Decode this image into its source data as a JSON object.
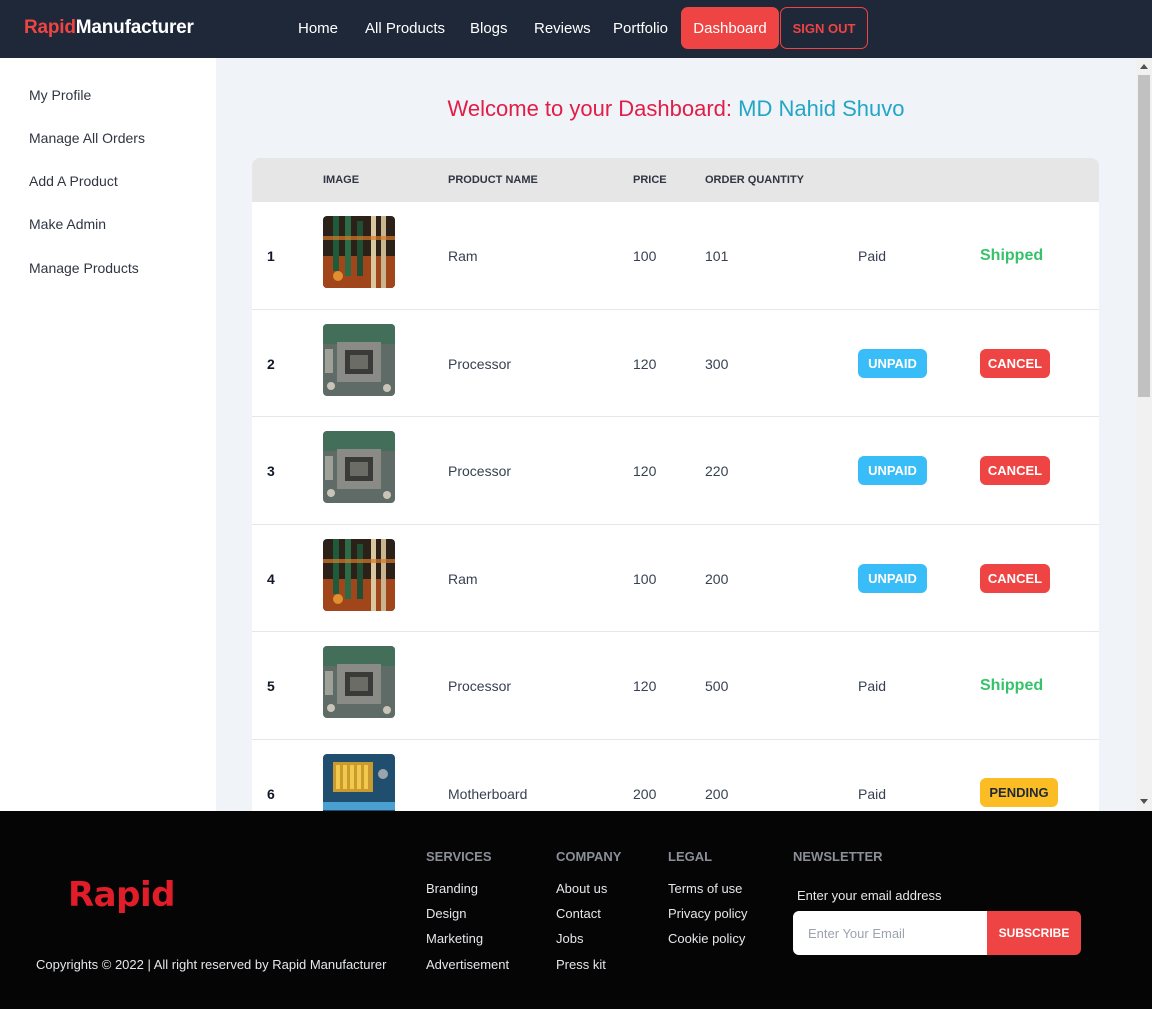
{
  "navbar": {
    "brand_accent": "Rapid",
    "brand_rest": "Manufacturer",
    "links": [
      "Home",
      "All Products",
      "Blogs",
      "Reviews",
      "Portfolio"
    ],
    "dashboard": "Dashboard",
    "signout": "SIGN OUT"
  },
  "sidebar": {
    "items": [
      "My Profile",
      "Manage All Orders",
      "Add A Product",
      "Make Admin",
      "Manage Products"
    ]
  },
  "main": {
    "welcome_prefix": "Welcome to your Dashboard:",
    "user_name": "MD Nahid Shuvo"
  },
  "table": {
    "headers": [
      "IMAGE",
      "PRODUCT NAME",
      "PRICE",
      "ORDER QUANTITY"
    ],
    "rows": [
      {
        "num": "1",
        "image": "ram",
        "name": "Ram",
        "price": "100",
        "qty": "101",
        "payment": "Paid",
        "status": "Shipped"
      },
      {
        "num": "2",
        "image": "processor",
        "name": "Processor",
        "price": "120",
        "qty": "300",
        "payment": "UNPAID",
        "status": "CANCEL"
      },
      {
        "num": "3",
        "image": "processor",
        "name": "Processor",
        "price": "120",
        "qty": "220",
        "payment": "UNPAID",
        "status": "CANCEL"
      },
      {
        "num": "4",
        "image": "ram",
        "name": "Ram",
        "price": "100",
        "qty": "200",
        "payment": "UNPAID",
        "status": "CANCEL"
      },
      {
        "num": "5",
        "image": "processor",
        "name": "Processor",
        "price": "120",
        "qty": "500",
        "payment": "Paid",
        "status": "Shipped"
      },
      {
        "num": "6",
        "image": "motherboard",
        "name": "Motherboard",
        "price": "200",
        "qty": "200",
        "payment": "Paid",
        "status": "PENDING"
      }
    ]
  },
  "footer": {
    "logo": "Rapid",
    "copyright": "Copyrights © 2022 | All right reserved by Rapid Manufacturer",
    "services": {
      "title": "SERVICES",
      "links": [
        "Branding",
        "Design",
        "Marketing",
        "Advertisement"
      ]
    },
    "company": {
      "title": "COMPANY",
      "links": [
        "About us",
        "Contact",
        "Jobs",
        "Press kit"
      ]
    },
    "legal": {
      "title": "LEGAL",
      "links": [
        "Terms of use",
        "Privacy policy",
        "Cookie policy"
      ]
    },
    "newsletter": {
      "title": "NEWSLETTER",
      "label": "Enter your email address",
      "placeholder": "Enter Your Email",
      "button": "SUBSCRIBE"
    }
  },
  "colors": {
    "accent": "#ef4444",
    "navbar_bg": "#1e2838",
    "name_color": "#22a6c7",
    "shipped": "#36c26a",
    "unpaid": "#38bdf8",
    "pending": "#fbbd23"
  }
}
